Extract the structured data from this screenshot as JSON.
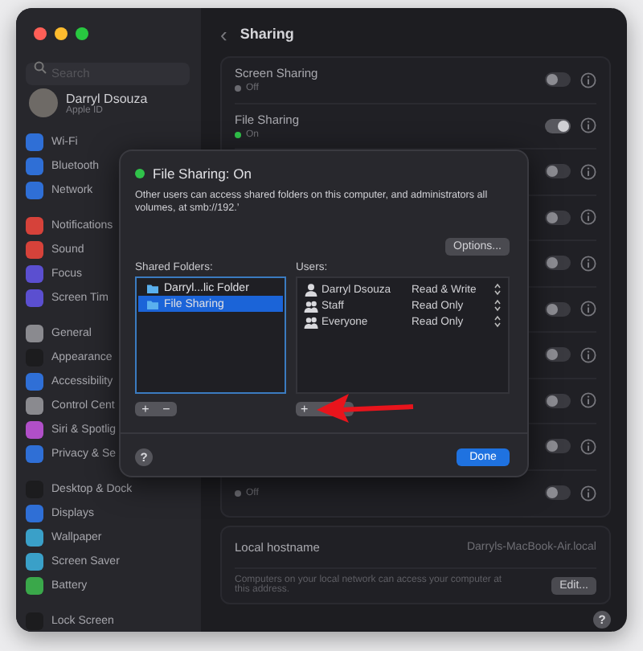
{
  "window": {
    "title": "Sharing",
    "back": "‹"
  },
  "sidebar": {
    "search": {
      "placeholder": "Search"
    },
    "profile": {
      "name": "Darryl Dsouza",
      "subtitle": "Apple ID"
    },
    "groups": [
      {
        "items": [
          {
            "label": "Wi-Fi",
            "color": "#2f6fd6"
          },
          {
            "label": "Bluetooth",
            "color": "#2f6fd6"
          },
          {
            "label": "Network",
            "color": "#2f6fd6"
          }
        ]
      },
      {
        "items": [
          {
            "label": "Notifications",
            "color": "#d6423a"
          },
          {
            "label": "Sound",
            "color": "#d6423a"
          },
          {
            "label": "Focus",
            "color": "#5b4fd0"
          },
          {
            "label": "Screen Tim",
            "color": "#5b4fd0"
          }
        ]
      },
      {
        "items": [
          {
            "label": "General",
            "color": "#8a8a8f"
          },
          {
            "label": "Appearance",
            "color": "#1c1c1e"
          },
          {
            "label": "Accessibility",
            "color": "#2f6fd6"
          },
          {
            "label": "Control Cent",
            "color": "#8a8a8f"
          },
          {
            "label": "Siri & Spotlig",
            "color": "#b04fc8"
          },
          {
            "label": "Privacy & Se",
            "color": "#2f6fd6"
          }
        ]
      },
      {
        "items": [
          {
            "label": "Desktop & Dock",
            "color": "#1c1c1e"
          },
          {
            "label": "Displays",
            "color": "#2f6fd6"
          },
          {
            "label": "Wallpaper",
            "color": "#3aa0c8"
          },
          {
            "label": "Screen Saver",
            "color": "#3aa0c8"
          },
          {
            "label": "Battery",
            "color": "#3aa84a"
          }
        ]
      },
      {
        "items": [
          {
            "label": "Lock Screen",
            "color": "#1c1c1e"
          }
        ]
      }
    ]
  },
  "services": [
    {
      "title": "Screen Sharing",
      "status": "Off",
      "on": false
    },
    {
      "title": "File Sharing",
      "status": "On",
      "on": true
    },
    {
      "on": false
    },
    {
      "on": false
    },
    {
      "on": false
    },
    {
      "on": false
    },
    {
      "on": false
    },
    {
      "on": false
    },
    {
      "on": false
    },
    {
      "status": "Off",
      "on": false
    }
  ],
  "hostname": {
    "label": "Local hostname",
    "value": "Darryls-MacBook-Air.local",
    "description": "Computers on your local network can access your computer at this address.",
    "button": "Edit..."
  },
  "help": "?",
  "sheet": {
    "title": "File Sharing: On",
    "on": true,
    "description": "Other users can access shared folders on this computer, and administrators all volumes, at smb://192.’",
    "options": "Options...",
    "folders_label": "Shared Folders:",
    "folders": [
      {
        "name": "Darryl...lic Folder",
        "selected": false
      },
      {
        "name": "File Sharing",
        "selected": true
      }
    ],
    "users_label": "Users:",
    "users": [
      {
        "kind": "person",
        "name": "Darryl Dsouza",
        "access": "Read & Write"
      },
      {
        "kind": "group",
        "name": "Staff",
        "access": "Read Only"
      },
      {
        "kind": "group",
        "name": "Everyone",
        "access": "Read Only"
      }
    ],
    "add": "+",
    "remove": "−",
    "help": "?",
    "done": "Done"
  }
}
